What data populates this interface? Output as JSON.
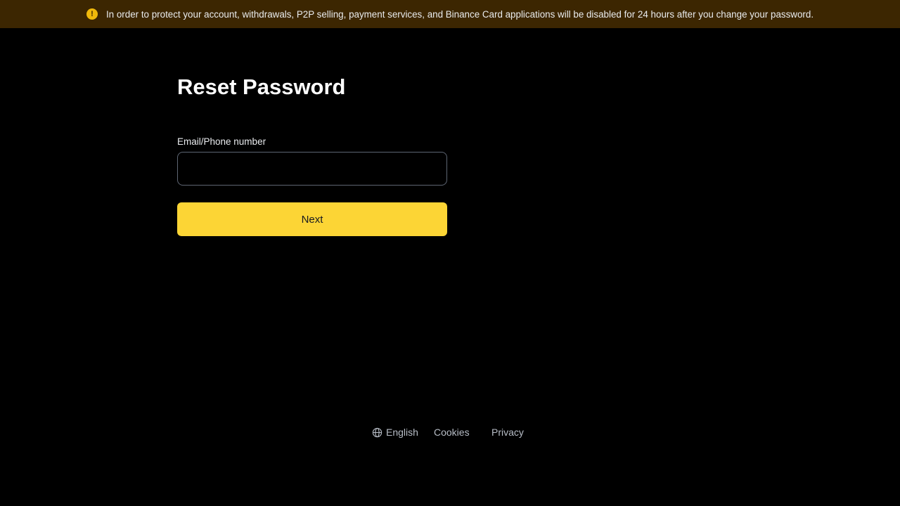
{
  "banner": {
    "icon": "exclamation-icon",
    "text": "In order to protect your account, withdrawals, P2P selling, payment services, and Binance Card applications will be disabled for 24 hours after you change your password."
  },
  "form": {
    "title": "Reset Password",
    "email_label": "Email/Phone number",
    "email_value": "",
    "email_placeholder": "",
    "next_label": "Next"
  },
  "footer": {
    "language_icon": "globe-icon",
    "language": "English",
    "cookies": "Cookies",
    "privacy": "Privacy"
  },
  "colors": {
    "background": "#000000",
    "banner_background": "#3c2601",
    "accent": "#fcd535",
    "warning_icon": "#f0b90b"
  }
}
